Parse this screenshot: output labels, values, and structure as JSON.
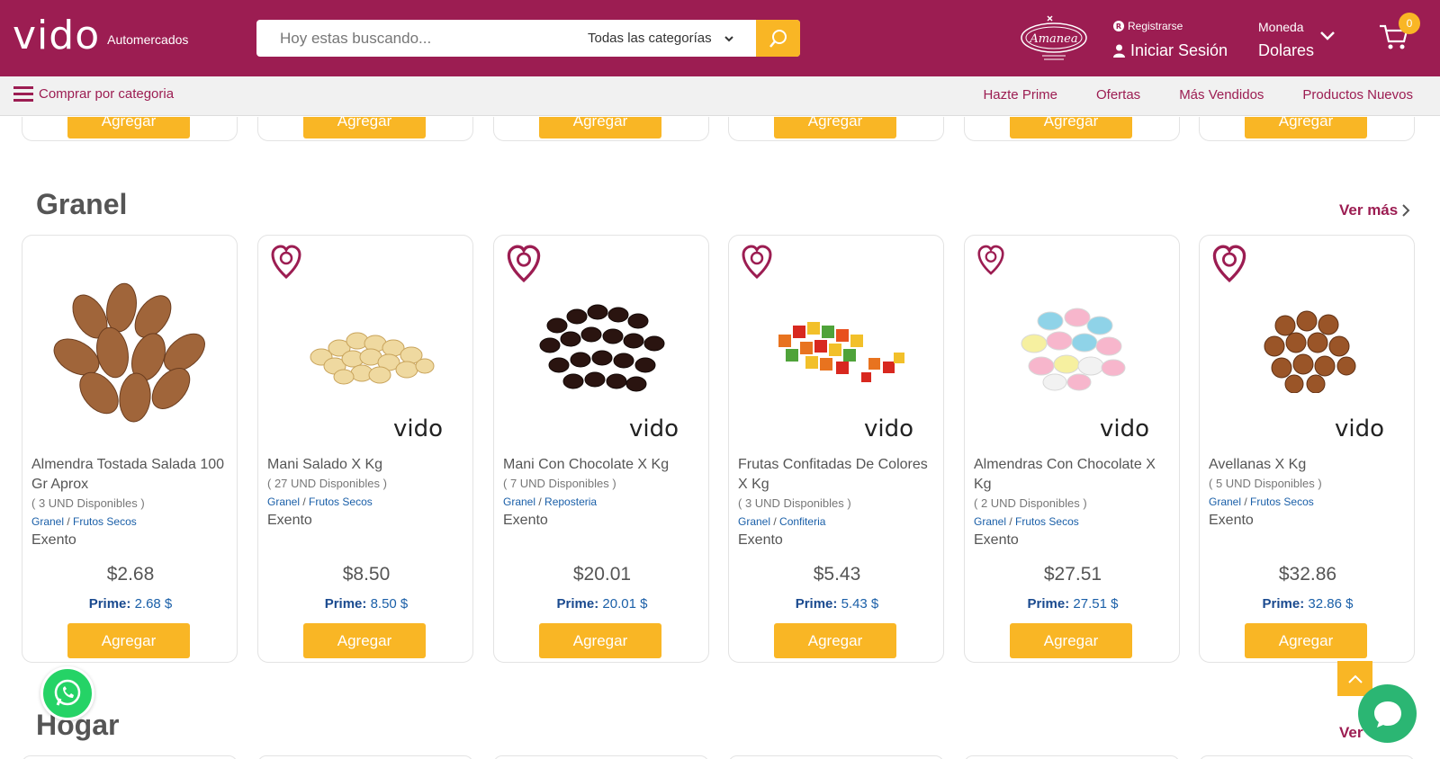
{
  "header": {
    "logo_text": "vido",
    "logo_subtitle": "Automercados",
    "search_placeholder": "Hoy estas buscando...",
    "category_select": "Todas las categorías",
    "brand_badge": "Amanea",
    "register_label": "Registrarse",
    "login_label": "Iniciar Sesión",
    "currency_label": "Moneda",
    "currency_value": "Dolares",
    "cart_count": "0"
  },
  "nav": {
    "category_menu": "Comprar por categoria",
    "links": [
      "Hazte Prime",
      "Ofertas",
      "Más Vendidos",
      "Productos Nuevos"
    ]
  },
  "top_row": {
    "button_label": "Agregar"
  },
  "section": {
    "title": "Granel",
    "see_more": "Ver más",
    "products": [
      {
        "name": "Almendra Tostada Salada 100 Gr Aprox",
        "stock": "( 3 UND Disponibles )",
        "cat1": "Granel",
        "cat2": "Frutos Secos",
        "tax": "Exento",
        "price": "$2.68",
        "prime_label": "Prime:",
        "prime_value": "2.68 $",
        "button": "Agregar",
        "image": "almonds"
      },
      {
        "name": "Mani Salado X Kg",
        "stock": "( 27 UND Disponibles )",
        "cat1": "Granel",
        "cat2": "Frutos Secos",
        "tax": "Exento",
        "price": "$8.50",
        "prime_label": "Prime:",
        "prime_value": "8.50 $",
        "button": "Agregar",
        "image": "peanuts"
      },
      {
        "name": "Mani Con Chocolate X Kg",
        "stock": "( 7 UND Disponibles )",
        "cat1": "Granel",
        "cat2": "Reposteria",
        "tax": "Exento",
        "price": "$20.01",
        "prime_label": "Prime:",
        "prime_value": "20.01 $",
        "button": "Agregar",
        "image": "chocolate-peanuts"
      },
      {
        "name": "Frutas Confitadas De Colores X Kg",
        "stock": "( 3 UND Disponibles )",
        "cat1": "Granel",
        "cat2": "Confiteria",
        "tax": "Exento",
        "price": "$5.43",
        "prime_label": "Prime:",
        "prime_value": "5.43 $",
        "button": "Agregar",
        "image": "candied-fruit"
      },
      {
        "name": "Almendras Con Chocolate X Kg",
        "stock": "( 2 UND Disponibles )",
        "cat1": "Granel",
        "cat2": "Frutos Secos",
        "tax": "Exento",
        "price": "$27.51",
        "prime_label": "Prime:",
        "prime_value": "27.51 $",
        "button": "Agregar",
        "image": "candy-almonds"
      },
      {
        "name": "Avellanas X Kg",
        "stock": "( 5 UND Disponibles )",
        "cat1": "Granel",
        "cat2": "Frutos Secos",
        "tax": "Exento",
        "price": "$32.86",
        "prime_label": "Prime:",
        "prime_value": "32.86 $",
        "button": "Agregar",
        "image": "hazelnuts"
      }
    ]
  },
  "next_section": {
    "title": "Hogar",
    "see_more": "Ver"
  },
  "colors": {
    "brand": "#9c1d52",
    "accent": "#f9b625",
    "link": "#1a5fa8"
  }
}
